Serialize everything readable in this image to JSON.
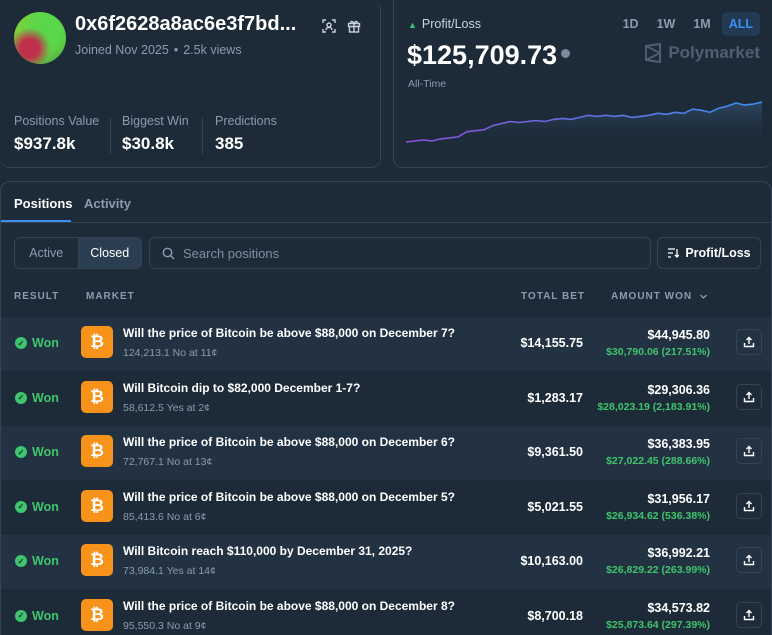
{
  "profile": {
    "username": "0x6f2628a8ac6e3f7bd...",
    "joined": "Joined Nov 2025",
    "views": "2.5k views",
    "stats": [
      {
        "label": "Positions Value",
        "value": "$937.8k"
      },
      {
        "label": "Biggest Win",
        "value": "$30.8k"
      },
      {
        "label": "Predictions",
        "value": "385"
      }
    ]
  },
  "pnl": {
    "label": "Profit/Loss",
    "value": "$125,709.73",
    "period_label": "All-Time",
    "ranges": [
      "1D",
      "1W",
      "1M",
      "ALL"
    ],
    "active_range": "ALL",
    "brand": "Polymarket",
    "series": [
      2,
      3,
      4,
      3,
      5,
      6,
      7,
      12,
      13,
      14,
      18,
      20,
      22,
      21,
      22,
      23,
      22,
      24,
      25,
      24,
      26,
      28,
      27,
      28,
      27,
      28,
      26,
      27,
      28,
      30,
      29,
      31,
      30,
      34,
      33,
      31,
      35,
      37,
      40,
      38,
      39,
      41
    ]
  },
  "tabs": [
    {
      "label": "Positions"
    },
    {
      "label": "Activity"
    }
  ],
  "filters": {
    "segments": [
      "Active",
      "Closed"
    ],
    "active_segment": "Closed",
    "search_placeholder": "Search positions",
    "sort_label": "Profit/Loss"
  },
  "table": {
    "headers": {
      "result": "RESULT",
      "market": "MARKET",
      "total_bet": "TOTAL BET",
      "amount_won": "AMOUNT WON"
    },
    "rows": [
      {
        "result": "Won",
        "title": "Will the price of Bitcoin be above $88,000 on December 7?",
        "subtitle": "124,213.1 No at 11¢",
        "total_bet": "$14,155.75",
        "amount_won": "$44,945.80",
        "profit": "$30,790.06 (217.51%)"
      },
      {
        "result": "Won",
        "title": "Will Bitcoin dip to $82,000 December 1-7?",
        "subtitle": "58,612.5 Yes at 2¢",
        "total_bet": "$1,283.17",
        "amount_won": "$29,306.36",
        "profit": "$28,023.19 (2,183.91%)"
      },
      {
        "result": "Won",
        "title": "Will the price of Bitcoin be above $88,000 on December 6?",
        "subtitle": "72,767.1 No at 13¢",
        "total_bet": "$9,361.50",
        "amount_won": "$36,383.95",
        "profit": "$27,022.45 (288.66%)"
      },
      {
        "result": "Won",
        "title": "Will the price of Bitcoin be above $88,000 on December 5?",
        "subtitle": "85,413.6 No at 6¢",
        "total_bet": "$5,021.55",
        "amount_won": "$31,956.17",
        "profit": "$26,934.62 (536.38%)"
      },
      {
        "result": "Won",
        "title": "Will Bitcoin reach $110,000 by December 31, 2025?",
        "subtitle": "73,984.1 Yes at 14¢",
        "total_bet": "$10,163.00",
        "amount_won": "$36,992.21",
        "profit": "$26,829.22 (263.99%)"
      },
      {
        "result": "Won",
        "title": "Will the price of Bitcoin be above $88,000 on December 8?",
        "subtitle": "95,550.3 No at 9¢",
        "total_bet": "$8,700.18",
        "amount_won": "$34,573.82",
        "profit": "$25,873.64 (297.39%)"
      }
    ]
  },
  "colors": {
    "accent": "#3c8ff0",
    "positive": "#3fc56b",
    "bitcoin": "#f7931a",
    "chart_start": "#8b4fd6",
    "chart_end": "#3c8ff0"
  }
}
